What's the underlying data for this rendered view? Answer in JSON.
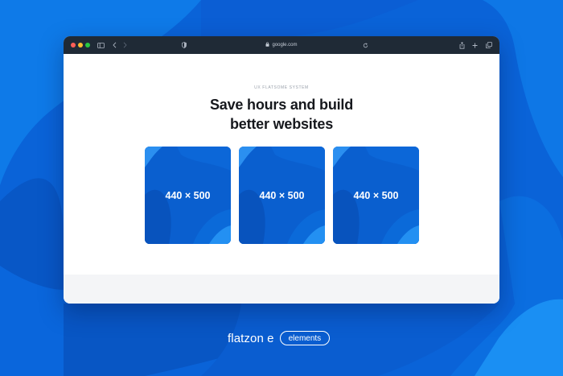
{
  "colors": {
    "background": "#0a63d8",
    "toolbar": "#1f2a36",
    "traffic_red": "#ff5f57",
    "traffic_yellow": "#febc2e",
    "traffic_green": "#28c840",
    "card": "#0a5fcf",
    "headline": "#16181d"
  },
  "browser": {
    "url": "google.com",
    "toolbar_icons": [
      "sidebar-icon",
      "back-icon",
      "forward-icon",
      "shield-icon",
      "lock-icon",
      "reload-icon",
      "share-icon",
      "new-tab-icon",
      "tabs-icon"
    ]
  },
  "page": {
    "eyebrow": "UX FLATSOME SYSTEM",
    "headline_line1": "Save hours and build",
    "headline_line2": "better websites",
    "cards": [
      {
        "label": "440 × 500"
      },
      {
        "label": "440 × 500"
      },
      {
        "label": "440 × 500"
      }
    ]
  },
  "brand": {
    "name": "flatzon e",
    "pill": "elements"
  }
}
